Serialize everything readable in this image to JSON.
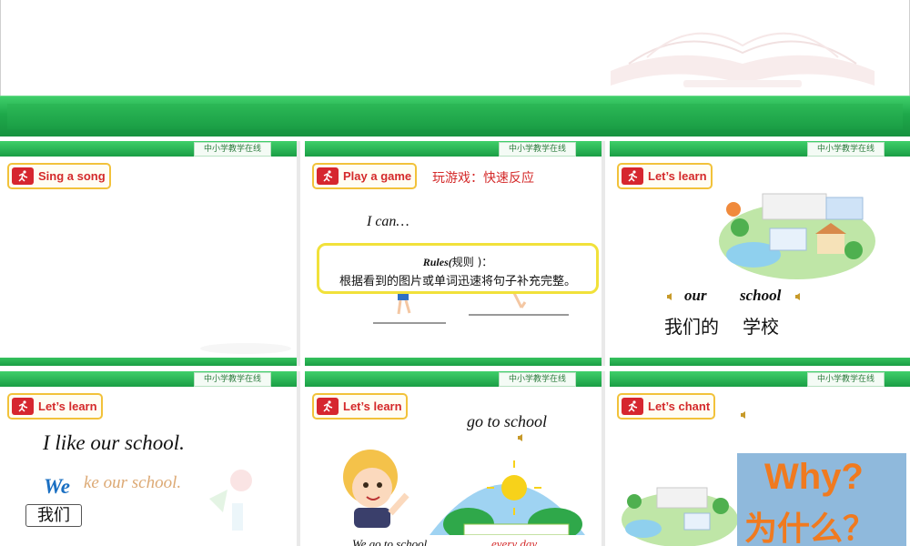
{
  "watermark": "中小学教学在线",
  "colors": {
    "green": "#1ea84a",
    "badge_red": "#d42a2a",
    "badge_border": "#f2c23a",
    "rules_border": "#f1e13a",
    "why_orange": "#f07a1f",
    "why_bg": "#8fb9dc"
  },
  "slides": [
    {
      "badge": "Sing a song"
    },
    {
      "badge": "Play a game",
      "subtitle": "玩游戏：快速反应",
      "prompt": "I can…",
      "rules_title": "Rules(",
      "rules_title_cn": "规则 )：",
      "rules_text": "根据看到的图片或单词迅速将句子补充完整。"
    },
    {
      "badge": "Let’s learn",
      "word_en_1": "our",
      "word_en_2": "school",
      "word_cn_1": "我们的",
      "word_cn_2": "学校"
    },
    {
      "badge": "Let’s learn",
      "sentence": "I like our school.",
      "we_word": "We",
      "sentence_faded": "ke our school.",
      "we_cn": "我们"
    },
    {
      "badge": "Let’s learn",
      "phrase": "go to school",
      "bottom_left": "We go to school",
      "bottom_right": "every day"
    },
    {
      "badge": "Let’s chant",
      "why_en": "Why?",
      "why_cn": "为什么？"
    }
  ]
}
